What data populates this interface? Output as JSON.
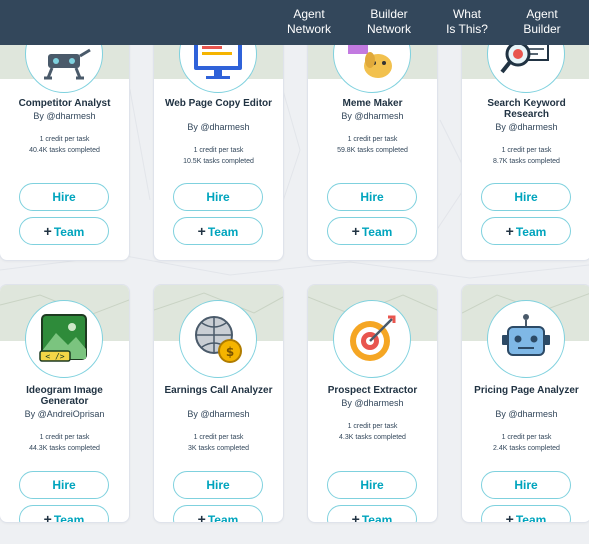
{
  "nav": {
    "items": [
      {
        "line1": "Agent",
        "line2": "Network"
      },
      {
        "line1": "Builder",
        "line2": "Network"
      },
      {
        "line1": "What",
        "line2": "Is This?"
      },
      {
        "line1": "Agent",
        "line2": "Builder"
      }
    ]
  },
  "buttons": {
    "hire": "Hire",
    "team_plus": "+",
    "team": "Team"
  },
  "cards": [
    {
      "title": "Competitor Analyst",
      "author": "By @dharmesh",
      "credit": "1 credit per task",
      "tasks": "40.4K tasks completed",
      "icon": "robot-arm-icon"
    },
    {
      "title": "Web Page Copy Editor",
      "author": "By @dharmesh",
      "credit": "1 credit per task",
      "tasks": "10.5K tasks completed",
      "icon": "monitor-icon"
    },
    {
      "title": "Meme Maker",
      "author": "By @dharmesh",
      "credit": "1 credit per task",
      "tasks": "59.8K tasks completed",
      "icon": "meme-dog-icon"
    },
    {
      "title": "Search Keyword Research",
      "author": "By @dharmesh",
      "credit": "1 credit per task",
      "tasks": "8.7K tasks completed",
      "icon": "magnifier-document-icon"
    },
    {
      "title": "Ideogram Image Generator",
      "author": "By @AndreiOprisan",
      "credit": "1 credit per task",
      "tasks": "44.3K tasks completed",
      "icon": "image-generator-icon"
    },
    {
      "title": "Earnings Call Analyzer",
      "author": "By @dharmesh",
      "credit": "1 credit per task",
      "tasks": "3K tasks completed",
      "icon": "globe-coin-icon"
    },
    {
      "title": "Prospect Extractor",
      "author": "By @dharmesh",
      "credit": "1 credit per task",
      "tasks": "4.3K tasks completed",
      "icon": "target-icon"
    },
    {
      "title": "Pricing Page Analyzer",
      "author": "By @dharmesh",
      "credit": "1 credit per task",
      "tasks": "2.4K tasks completed",
      "icon": "robot-head-icon"
    }
  ]
}
